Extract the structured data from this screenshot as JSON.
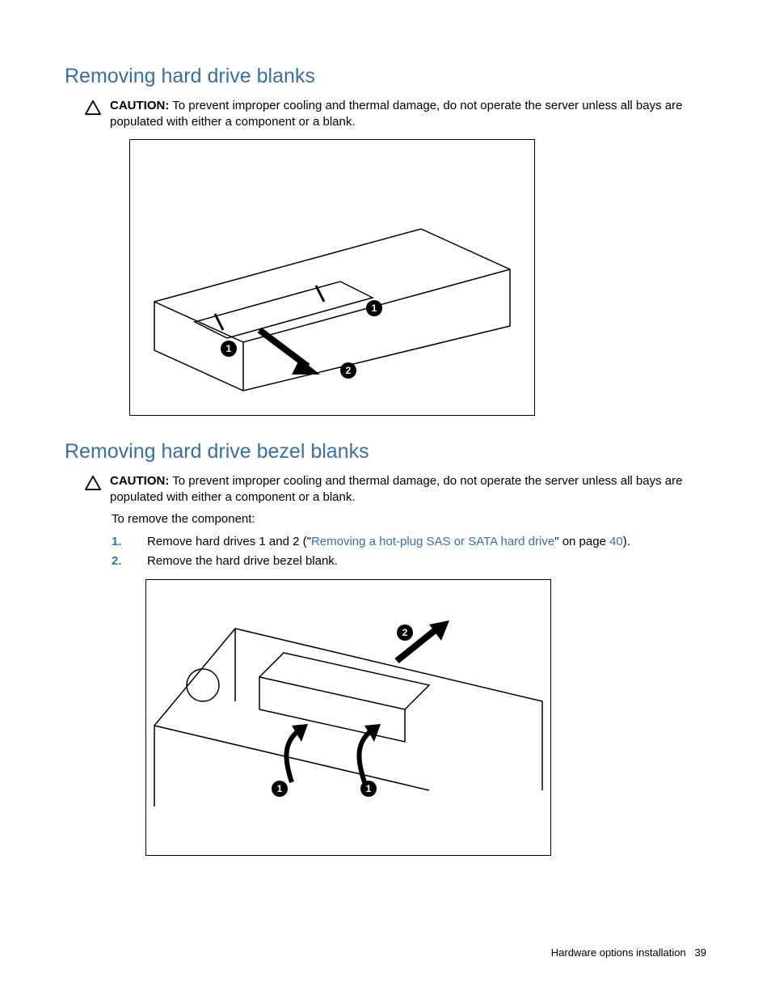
{
  "section1": {
    "heading": "Removing hard drive blanks",
    "caution_label": "CAUTION:",
    "caution_text": "To prevent improper cooling and thermal damage, do not operate the server unless all bays are populated with either a component or a blank.",
    "figure_callouts": [
      "1",
      "1",
      "2"
    ]
  },
  "section2": {
    "heading": "Removing hard drive bezel blanks",
    "caution_label": "CAUTION:",
    "caution_text": "To prevent improper cooling and thermal damage, do not operate the server unless all bays are populated with either a component or a blank.",
    "intro": "To remove the component:",
    "steps": [
      {
        "pre": "Remove hard drives 1 and 2 (\"",
        "link": "Removing a hot-plug SAS or SATA hard drive",
        "mid": "\" on page ",
        "page": "40",
        "post": ")."
      },
      {
        "pre": "Remove the hard drive bezel blank.",
        "link": "",
        "mid": "",
        "page": "",
        "post": ""
      }
    ],
    "figure_callouts": [
      "1",
      "1",
      "2"
    ]
  },
  "footer": {
    "section": "Hardware options installation",
    "page": "39"
  }
}
